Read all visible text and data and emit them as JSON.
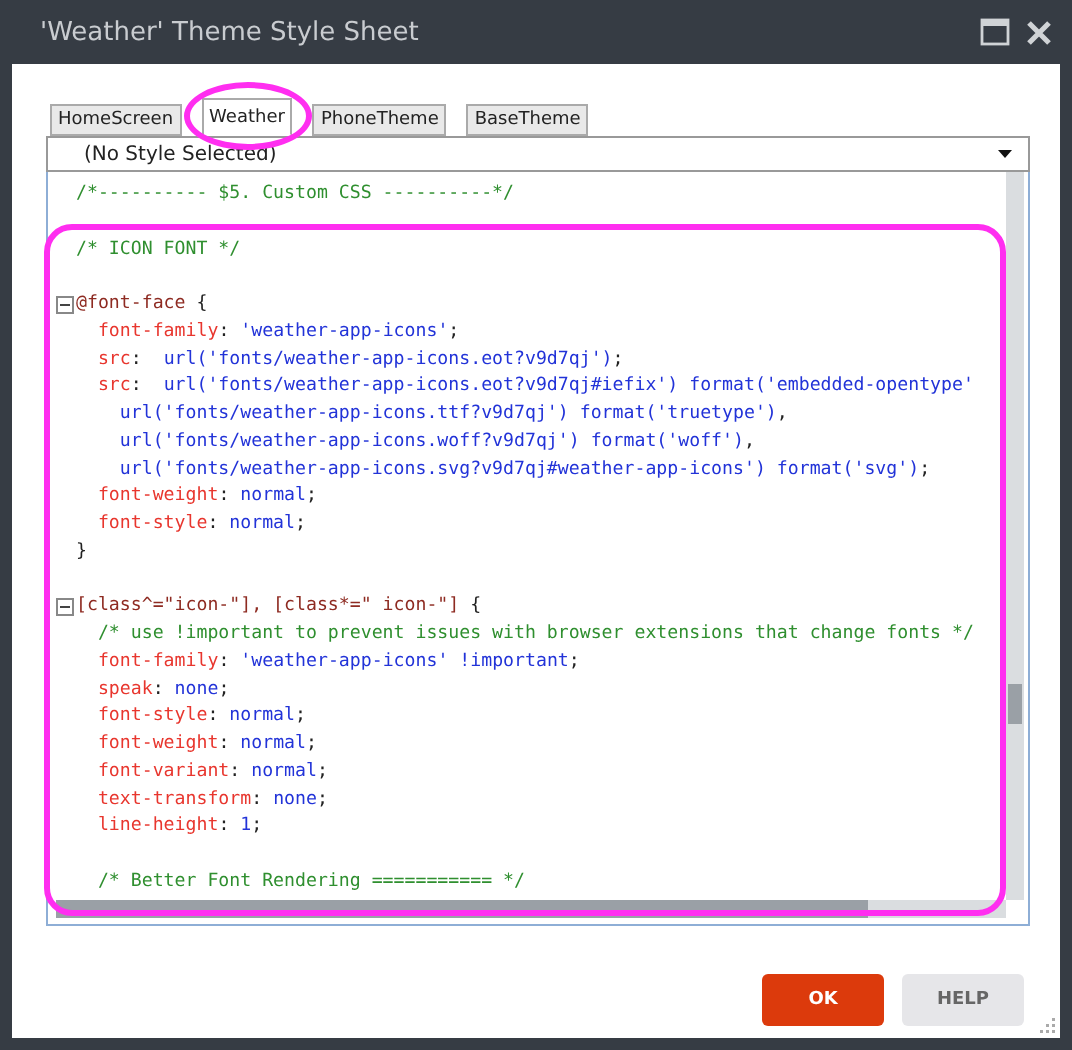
{
  "window": {
    "title": "'Weather' Theme Style Sheet"
  },
  "tabs": [
    {
      "label": "HomeScreen",
      "selected": false
    },
    {
      "label": "Weather",
      "selected": true
    },
    {
      "label": "PhoneTheme",
      "selected": false
    },
    {
      "label": "BaseTheme",
      "selected": false
    }
  ],
  "style_select": {
    "value": "(No Style Selected)"
  },
  "editor": {
    "lines": [
      {
        "fold": false,
        "tokens": [
          {
            "kind": "comment",
            "text": "/*---------- $5. Custom CSS ----------*/"
          }
        ]
      },
      {
        "fold": false
      },
      {
        "fold": false,
        "tokens": [
          {
            "kind": "comment",
            "text": "/* ICON FONT */"
          }
        ]
      },
      {
        "fold": false
      },
      {
        "fold": true,
        "tokens": [
          {
            "kind": "selector",
            "text": "@font-face"
          },
          {
            "kind": "punct",
            "text": " {"
          }
        ]
      },
      {
        "fold": false,
        "tokens": [
          {
            "kind": "property",
            "text": "  font-family"
          },
          {
            "kind": "punct",
            "text": ": "
          },
          {
            "kind": "value",
            "text": "'weather-app-icons'"
          },
          {
            "kind": "punct",
            "text": ";"
          }
        ]
      },
      {
        "fold": false,
        "tokens": [
          {
            "kind": "property",
            "text": "  src"
          },
          {
            "kind": "punct",
            "text": ":  "
          },
          {
            "kind": "value",
            "text": "url('fonts/weather-app-icons.eot?v9d7qj')"
          },
          {
            "kind": "punct",
            "text": ";"
          }
        ]
      },
      {
        "fold": false,
        "tokens": [
          {
            "kind": "property",
            "text": "  src"
          },
          {
            "kind": "punct",
            "text": ":  "
          },
          {
            "kind": "value",
            "text": "url('fonts/weather-app-icons.eot?v9d7qj#iefix') format('embedded-opentype'"
          }
        ]
      },
      {
        "fold": false,
        "tokens": [
          {
            "kind": "value",
            "text": "    url('fonts/weather-app-icons.ttf?v9d7qj') format('truetype')"
          },
          {
            "kind": "punct",
            "text": ","
          }
        ]
      },
      {
        "fold": false,
        "tokens": [
          {
            "kind": "value",
            "text": "    url('fonts/weather-app-icons.woff?v9d7qj') format('woff')"
          },
          {
            "kind": "punct",
            "text": ","
          }
        ]
      },
      {
        "fold": false,
        "tokens": [
          {
            "kind": "value",
            "text": "    url('fonts/weather-app-icons.svg?v9d7qj#weather-app-icons') format('svg')"
          },
          {
            "kind": "punct",
            "text": ";"
          }
        ]
      },
      {
        "fold": false,
        "tokens": [
          {
            "kind": "property",
            "text": "  font-weight"
          },
          {
            "kind": "punct",
            "text": ": "
          },
          {
            "kind": "value",
            "text": "normal"
          },
          {
            "kind": "punct",
            "text": ";"
          }
        ]
      },
      {
        "fold": false,
        "tokens": [
          {
            "kind": "property",
            "text": "  font-style"
          },
          {
            "kind": "punct",
            "text": ": "
          },
          {
            "kind": "value",
            "text": "normal"
          },
          {
            "kind": "punct",
            "text": ";"
          }
        ]
      },
      {
        "fold": false,
        "tokens": [
          {
            "kind": "punct",
            "text": "}"
          }
        ]
      },
      {
        "fold": false
      },
      {
        "fold": true,
        "tokens": [
          {
            "kind": "selector",
            "text": "[class^=\"icon-\"], [class*=\" icon-\"]"
          },
          {
            "kind": "punct",
            "text": " {"
          }
        ]
      },
      {
        "fold": false,
        "tokens": [
          {
            "kind": "comment",
            "text": "  /* use !important to prevent issues with browser extensions that change fonts */"
          }
        ]
      },
      {
        "fold": false,
        "tokens": [
          {
            "kind": "property",
            "text": "  font-family"
          },
          {
            "kind": "punct",
            "text": ": "
          },
          {
            "kind": "value",
            "text": "'weather-app-icons' !important"
          },
          {
            "kind": "punct",
            "text": ";"
          }
        ]
      },
      {
        "fold": false,
        "tokens": [
          {
            "kind": "property",
            "text": "  speak"
          },
          {
            "kind": "punct",
            "text": ": "
          },
          {
            "kind": "value",
            "text": "none"
          },
          {
            "kind": "punct",
            "text": ";"
          }
        ]
      },
      {
        "fold": false,
        "tokens": [
          {
            "kind": "property",
            "text": "  font-style"
          },
          {
            "kind": "punct",
            "text": ": "
          },
          {
            "kind": "value",
            "text": "normal"
          },
          {
            "kind": "punct",
            "text": ";"
          }
        ]
      },
      {
        "fold": false,
        "tokens": [
          {
            "kind": "property",
            "text": "  font-weight"
          },
          {
            "kind": "punct",
            "text": ": "
          },
          {
            "kind": "value",
            "text": "normal"
          },
          {
            "kind": "punct",
            "text": ";"
          }
        ]
      },
      {
        "fold": false,
        "tokens": [
          {
            "kind": "property",
            "text": "  font-variant"
          },
          {
            "kind": "punct",
            "text": ": "
          },
          {
            "kind": "value",
            "text": "normal"
          },
          {
            "kind": "punct",
            "text": ";"
          }
        ]
      },
      {
        "fold": false,
        "tokens": [
          {
            "kind": "property",
            "text": "  text-transform"
          },
          {
            "kind": "punct",
            "text": ": "
          },
          {
            "kind": "value",
            "text": "none"
          },
          {
            "kind": "punct",
            "text": ";"
          }
        ]
      },
      {
        "fold": false,
        "tokens": [
          {
            "kind": "property",
            "text": "  line-height"
          },
          {
            "kind": "punct",
            "text": ": "
          },
          {
            "kind": "value",
            "text": "1"
          },
          {
            "kind": "punct",
            "text": ";"
          }
        ]
      },
      {
        "fold": false
      },
      {
        "fold": false,
        "tokens": [
          {
            "kind": "comment",
            "text": "  /* Better Font Rendering =========== */"
          }
        ]
      }
    ]
  },
  "buttons": [
    {
      "label": "OK",
      "kind": "primary"
    },
    {
      "label": "HELP",
      "kind": "secondary"
    }
  ]
}
